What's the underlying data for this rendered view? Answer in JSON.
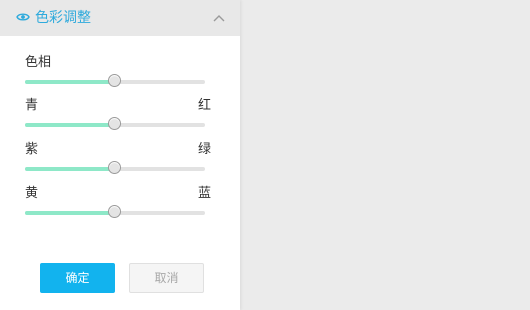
{
  "panel": {
    "title": "色彩调整",
    "title_icon": "eye-icon",
    "collapse_icon": "chevron-up-icon",
    "accent_color": "#2eaadc"
  },
  "sliders": [
    {
      "left_label": "色相",
      "right_label": "",
      "value": 0.5
    },
    {
      "left_label": "青",
      "right_label": "红",
      "value": 0.5
    },
    {
      "left_label": "紫",
      "right_label": "绿",
      "value": 0.5
    },
    {
      "left_label": "黄",
      "right_label": "蓝",
      "value": 0.5
    }
  ],
  "buttons": {
    "confirm_label": "确定",
    "cancel_label": "取消",
    "confirm_color": "#12b3ee",
    "slider_fill_color": "#8ee8c8"
  }
}
